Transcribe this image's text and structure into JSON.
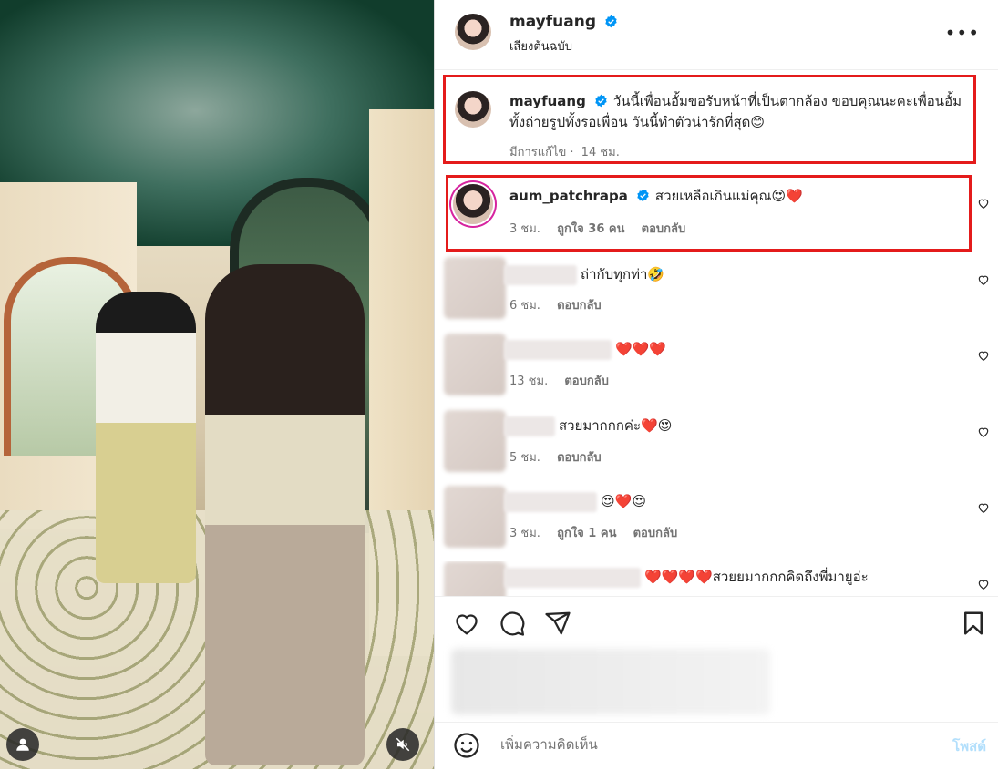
{
  "post": {
    "username": "mayfuang",
    "audio": "เสียงต้นฉบับ",
    "more_label": "•••"
  },
  "caption": {
    "username": "mayfuang",
    "text": "วันนี้เพื่อนอั้มขอรับหน้าที่เป็นตากล้อง ขอบคุณนะคะเพื่อนอั้ม ทั้งถ่ายรูปทั้งรอเพื่อน วันนี้ทำตัวน่ารักที่สุด😊",
    "edited": "มีการแก้ไข",
    "time": "14 ชม."
  },
  "comments": [
    {
      "username": "aum_patchrapa",
      "text": "สวยเหลือเกินแม่คุณ😍❤️",
      "time": "3 ชม.",
      "likes": "ถูกใจ 36 คน",
      "reply": "ตอบกลับ"
    },
    {
      "username": "",
      "text": "ถ่ากับทุกท่า🤣",
      "time": "6 ชม.",
      "likes": "",
      "reply": "ตอบกลับ"
    },
    {
      "username": "",
      "text": "❤️❤️❤️",
      "time": "13 ชม.",
      "likes": "",
      "reply": "ตอบกลับ"
    },
    {
      "username": "",
      "text": "สวยมากกกค่ะ❤️😍",
      "time": "5 ชม.",
      "likes": "",
      "reply": "ตอบกลับ"
    },
    {
      "username": "",
      "text": "😍❤️😍",
      "time": "3 ชม.",
      "likes": "ถูกใจ 1 คน",
      "reply": "ตอบกลับ"
    },
    {
      "username": "",
      "text": "❤️❤️❤️❤️สวยยมากกกคิดถึงพี่มายูอ่ะ",
      "time": "",
      "likes": "",
      "reply": ""
    }
  ],
  "composer": {
    "placeholder": "เพิ่มความคิดเห็น",
    "post_label": "โพสต์"
  },
  "icons": {
    "verified": "verified-badge-icon",
    "heart": "heart-icon",
    "comment": "comment-icon",
    "share": "share-icon",
    "save": "bookmark-icon",
    "emoji": "emoji-icon",
    "user": "user-tag-icon",
    "mute": "muted-audio-icon"
  },
  "colors": {
    "highlight_box": "#e41b1b",
    "verified": "#0095f6",
    "post_disabled": "#b2dffc"
  }
}
